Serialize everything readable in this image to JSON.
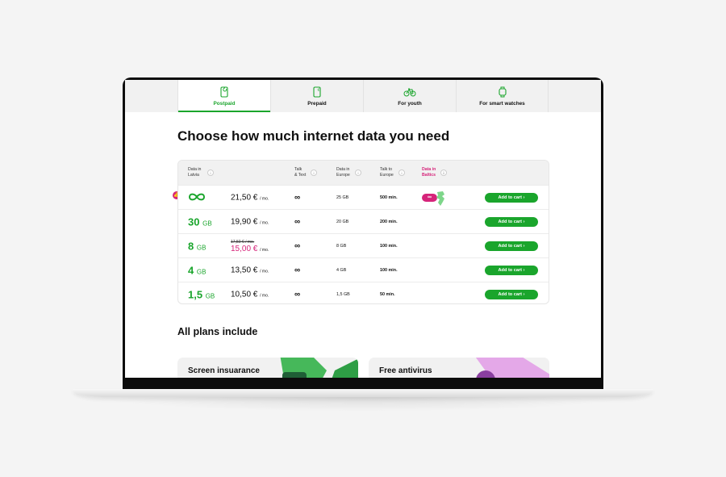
{
  "tabs": [
    {
      "label": "Postpaid",
      "icon": "phone-refresh-icon",
      "active": true
    },
    {
      "label": "Prepaid",
      "icon": "phone-euro-icon",
      "active": false
    },
    {
      "label": "For youth",
      "icon": "bicycle-icon",
      "active": false
    },
    {
      "label": "For smart watches",
      "icon": "smartwatch-icon",
      "active": false
    }
  ],
  "heading": "Choose how much internet data you need",
  "table": {
    "headers": {
      "data_latvia": [
        "Data in",
        "Latvia"
      ],
      "talk_text": [
        "Talk",
        "& Text"
      ],
      "data_europe": [
        "Data in",
        "Europe"
      ],
      "talk_europe": [
        "Talk to",
        "Europe"
      ],
      "data_baltics": [
        "Data in",
        "Baltics"
      ]
    },
    "info_glyph": "i",
    "rows": [
      {
        "data": "∞",
        "unit": "",
        "old_price": "",
        "price": "21,50 €",
        "per": "/ mo.",
        "talk": "∞",
        "eu_data": "25 GB",
        "eu_talk": "500 min.",
        "baltics": "∞",
        "cta": "Add to cart ›",
        "recommended": true
      },
      {
        "data": "30",
        "unit": "GB",
        "old_price": "",
        "price": "19,90 €",
        "per": "/ mo.",
        "talk": "∞",
        "eu_data": "20 GB",
        "eu_talk": "200 min.",
        "baltics": "",
        "cta": "Add to cart ›"
      },
      {
        "data": "8",
        "unit": "GB",
        "old_price": "17,50 € / mo.",
        "price": "15,00 €",
        "per": "/ mo.",
        "talk": "∞",
        "eu_data": "8 GB",
        "eu_talk": "100 min.",
        "baltics": "",
        "cta": "Add to cart ›"
      },
      {
        "data": "4",
        "unit": "GB",
        "old_price": "",
        "price": "13,50 €",
        "per": "/ mo.",
        "talk": "∞",
        "eu_data": "4 GB",
        "eu_talk": "100 min.",
        "baltics": "",
        "cta": "Add to cart ›"
      },
      {
        "data": "1,5",
        "unit": "GB",
        "old_price": "",
        "price": "10,50 €",
        "per": "/ mo.",
        "talk": "∞",
        "eu_data": "1,5 GB",
        "eu_talk": "50 min.",
        "baltics": "",
        "cta": "Add to cart ›"
      }
    ],
    "thumb_glyph": "👍"
  },
  "subheading": "All plans include",
  "promos": [
    {
      "title": "Screen insuarance"
    },
    {
      "title": "Free antivirus"
    }
  ],
  "colors": {
    "green": "#1aa52c",
    "pink": "#d6247a"
  }
}
